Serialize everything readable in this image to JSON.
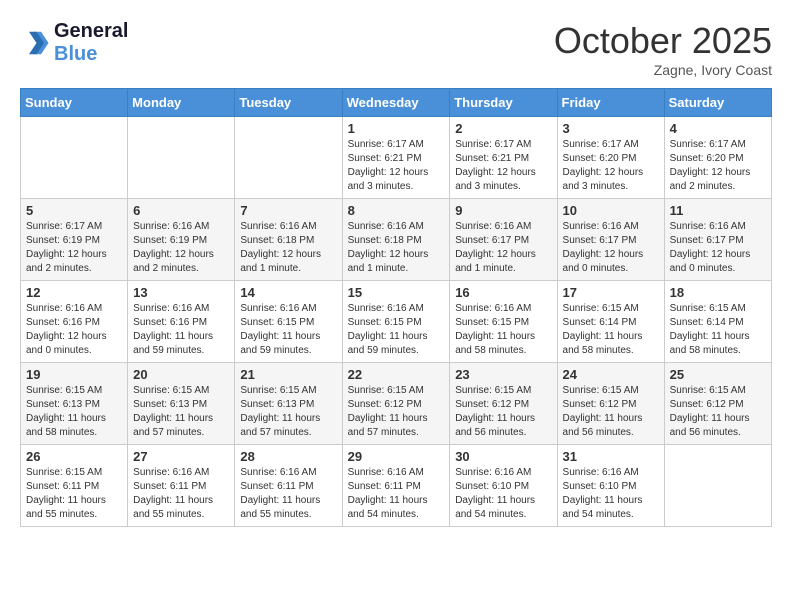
{
  "header": {
    "logo_line1": "General",
    "logo_line2": "Blue",
    "month": "October 2025",
    "location": "Zagne, Ivory Coast"
  },
  "weekdays": [
    "Sunday",
    "Monday",
    "Tuesday",
    "Wednesday",
    "Thursday",
    "Friday",
    "Saturday"
  ],
  "weeks": [
    [
      {
        "day": "",
        "info": ""
      },
      {
        "day": "",
        "info": ""
      },
      {
        "day": "",
        "info": ""
      },
      {
        "day": "1",
        "info": "Sunrise: 6:17 AM\nSunset: 6:21 PM\nDaylight: 12 hours\nand 3 minutes."
      },
      {
        "day": "2",
        "info": "Sunrise: 6:17 AM\nSunset: 6:21 PM\nDaylight: 12 hours\nand 3 minutes."
      },
      {
        "day": "3",
        "info": "Sunrise: 6:17 AM\nSunset: 6:20 PM\nDaylight: 12 hours\nand 3 minutes."
      },
      {
        "day": "4",
        "info": "Sunrise: 6:17 AM\nSunset: 6:20 PM\nDaylight: 12 hours\nand 2 minutes."
      }
    ],
    [
      {
        "day": "5",
        "info": "Sunrise: 6:17 AM\nSunset: 6:19 PM\nDaylight: 12 hours\nand 2 minutes."
      },
      {
        "day": "6",
        "info": "Sunrise: 6:16 AM\nSunset: 6:19 PM\nDaylight: 12 hours\nand 2 minutes."
      },
      {
        "day": "7",
        "info": "Sunrise: 6:16 AM\nSunset: 6:18 PM\nDaylight: 12 hours\nand 1 minute."
      },
      {
        "day": "8",
        "info": "Sunrise: 6:16 AM\nSunset: 6:18 PM\nDaylight: 12 hours\nand 1 minute."
      },
      {
        "day": "9",
        "info": "Sunrise: 6:16 AM\nSunset: 6:17 PM\nDaylight: 12 hours\nand 1 minute."
      },
      {
        "day": "10",
        "info": "Sunrise: 6:16 AM\nSunset: 6:17 PM\nDaylight: 12 hours\nand 0 minutes."
      },
      {
        "day": "11",
        "info": "Sunrise: 6:16 AM\nSunset: 6:17 PM\nDaylight: 12 hours\nand 0 minutes."
      }
    ],
    [
      {
        "day": "12",
        "info": "Sunrise: 6:16 AM\nSunset: 6:16 PM\nDaylight: 12 hours\nand 0 minutes."
      },
      {
        "day": "13",
        "info": "Sunrise: 6:16 AM\nSunset: 6:16 PM\nDaylight: 11 hours\nand 59 minutes."
      },
      {
        "day": "14",
        "info": "Sunrise: 6:16 AM\nSunset: 6:15 PM\nDaylight: 11 hours\nand 59 minutes."
      },
      {
        "day": "15",
        "info": "Sunrise: 6:16 AM\nSunset: 6:15 PM\nDaylight: 11 hours\nand 59 minutes."
      },
      {
        "day": "16",
        "info": "Sunrise: 6:16 AM\nSunset: 6:15 PM\nDaylight: 11 hours\nand 58 minutes."
      },
      {
        "day": "17",
        "info": "Sunrise: 6:15 AM\nSunset: 6:14 PM\nDaylight: 11 hours\nand 58 minutes."
      },
      {
        "day": "18",
        "info": "Sunrise: 6:15 AM\nSunset: 6:14 PM\nDaylight: 11 hours\nand 58 minutes."
      }
    ],
    [
      {
        "day": "19",
        "info": "Sunrise: 6:15 AM\nSunset: 6:13 PM\nDaylight: 11 hours\nand 58 minutes."
      },
      {
        "day": "20",
        "info": "Sunrise: 6:15 AM\nSunset: 6:13 PM\nDaylight: 11 hours\nand 57 minutes."
      },
      {
        "day": "21",
        "info": "Sunrise: 6:15 AM\nSunset: 6:13 PM\nDaylight: 11 hours\nand 57 minutes."
      },
      {
        "day": "22",
        "info": "Sunrise: 6:15 AM\nSunset: 6:12 PM\nDaylight: 11 hours\nand 57 minutes."
      },
      {
        "day": "23",
        "info": "Sunrise: 6:15 AM\nSunset: 6:12 PM\nDaylight: 11 hours\nand 56 minutes."
      },
      {
        "day": "24",
        "info": "Sunrise: 6:15 AM\nSunset: 6:12 PM\nDaylight: 11 hours\nand 56 minutes."
      },
      {
        "day": "25",
        "info": "Sunrise: 6:15 AM\nSunset: 6:12 PM\nDaylight: 11 hours\nand 56 minutes."
      }
    ],
    [
      {
        "day": "26",
        "info": "Sunrise: 6:15 AM\nSunset: 6:11 PM\nDaylight: 11 hours\nand 55 minutes."
      },
      {
        "day": "27",
        "info": "Sunrise: 6:16 AM\nSunset: 6:11 PM\nDaylight: 11 hours\nand 55 minutes."
      },
      {
        "day": "28",
        "info": "Sunrise: 6:16 AM\nSunset: 6:11 PM\nDaylight: 11 hours\nand 55 minutes."
      },
      {
        "day": "29",
        "info": "Sunrise: 6:16 AM\nSunset: 6:11 PM\nDaylight: 11 hours\nand 54 minutes."
      },
      {
        "day": "30",
        "info": "Sunrise: 6:16 AM\nSunset: 6:10 PM\nDaylight: 11 hours\nand 54 minutes."
      },
      {
        "day": "31",
        "info": "Sunrise: 6:16 AM\nSunset: 6:10 PM\nDaylight: 11 hours\nand 54 minutes."
      },
      {
        "day": "",
        "info": ""
      }
    ]
  ]
}
